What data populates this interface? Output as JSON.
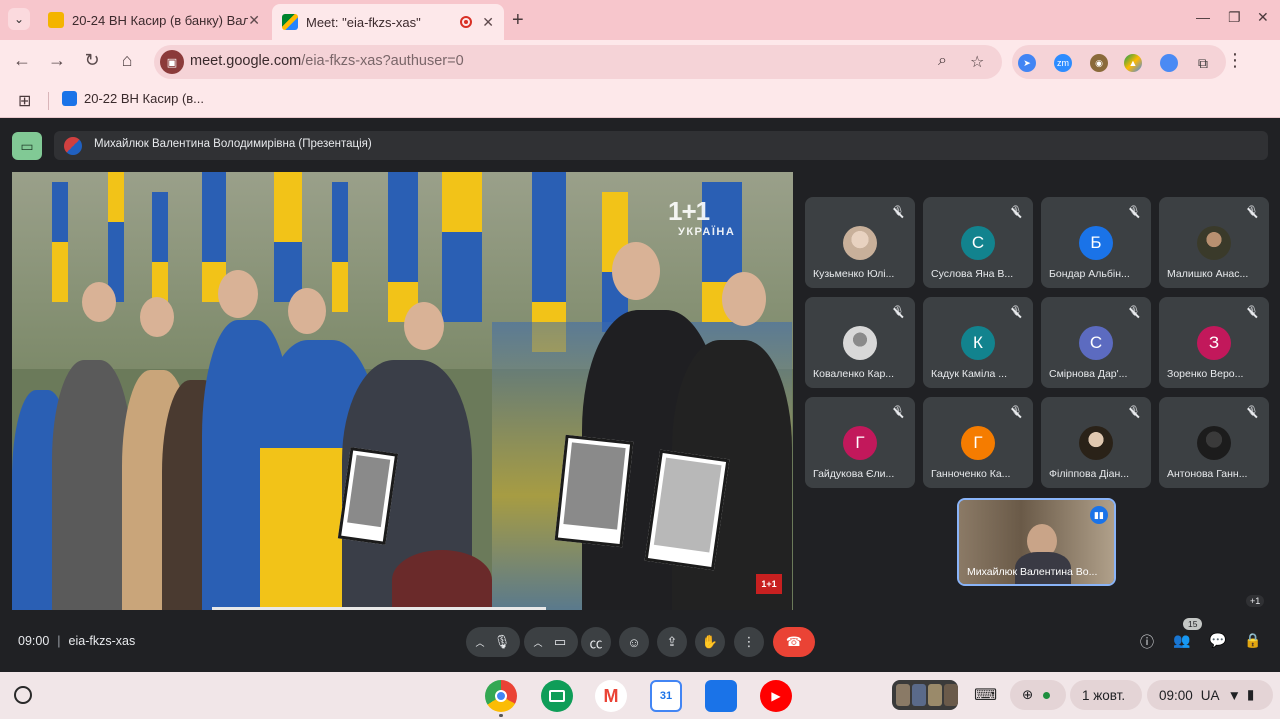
{
  "browser": {
    "tabs": [
      {
        "title": "20-24 ВН Касир (в банку) Вал",
        "active": false,
        "favicon_color": "#0f9d58"
      },
      {
        "title": "Meet: \"eia-fkzs-xas\"",
        "active": true,
        "favicon_color": "#00832d"
      }
    ],
    "url_host": "meet.google.com",
    "url_path": "/eia-fkzs-xas?authuser=0",
    "bookmarks": [
      {
        "label": "20-22 ВН Касир (в..."
      }
    ],
    "accent": "#f7c6cc"
  },
  "meet": {
    "presenter_label": "Михайлюк Валентина Володимирівна (Презентація)",
    "video_logo": "1+1",
    "video_logo_sub": "УКРАЇНА",
    "video_corner_logo": "1+1",
    "participants": [
      {
        "name": "Кузьменко Юлі...",
        "initial": "",
        "color": "",
        "photo": true
      },
      {
        "name": "Суслова Яна В...",
        "initial": "С",
        "color": "#12838e",
        "photo": false
      },
      {
        "name": "Бондар Альбін...",
        "initial": "Б",
        "color": "#1a73e8",
        "photo": false
      },
      {
        "name": "Малишко Анас...",
        "initial": "",
        "color": "",
        "photo": true
      },
      {
        "name": "Коваленко Кар...",
        "initial": "",
        "color": "",
        "photo": true
      },
      {
        "name": "Кадук Каміла ...",
        "initial": "К",
        "color": "#12838e",
        "photo": false
      },
      {
        "name": "Смірнова Дар'...",
        "initial": "С",
        "color": "#5c6bc0",
        "photo": false
      },
      {
        "name": "Зоренко Веро...",
        "initial": "З",
        "color": "#c2185b",
        "photo": false
      },
      {
        "name": "Гайдукова Єли...",
        "initial": "Г",
        "color": "#c2185b",
        "photo": false
      },
      {
        "name": "Ганноченко Ка...",
        "initial": "Г",
        "color": "#f57c00",
        "photo": false
      },
      {
        "name": "Філіппова Діан...",
        "initial": "",
        "color": "",
        "photo": true
      },
      {
        "name": "Антонова Ганн...",
        "initial": "",
        "color": "",
        "photo": true
      }
    ],
    "self_name": "Михайлюк Валентина Во...",
    "more_count": "+1",
    "time": "09:00",
    "meeting_code": "eia-fkzs-xas",
    "people_count": "15",
    "end_color": "#ea4335"
  },
  "shelf": {
    "date": "1 жовт.",
    "time": "09:00",
    "lang": "UA",
    "apps": [
      {
        "name": "chrome-icon",
        "label": ""
      },
      {
        "name": "classroom-icon",
        "label": ""
      },
      {
        "name": "gmail-icon",
        "label": "M"
      },
      {
        "name": "calendar-icon",
        "label": "31"
      },
      {
        "name": "files-icon",
        "label": ""
      },
      {
        "name": "youtube-icon",
        "label": "▶"
      }
    ]
  }
}
